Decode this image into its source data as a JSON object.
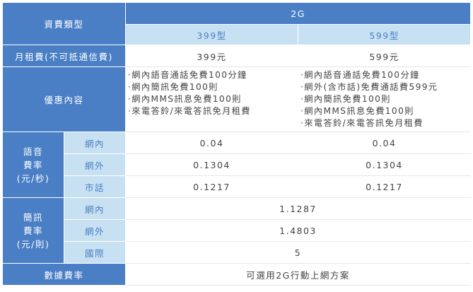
{
  "header": {
    "fee_type": "資費類型",
    "network": "2G",
    "plan_399": "399型",
    "plan_599": "599型"
  },
  "monthly": {
    "label": "月租費(不可抵通信費)",
    "p399": "399元",
    "p599": "599元"
  },
  "offers": {
    "label": "優惠內容",
    "p399": [
      "·網內語音通話免費100分鐘",
      "·網內簡訊免費100則",
      "·網內MMS訊息免費100則",
      "·來電答鈴/來電答訊免月租費"
    ],
    "p599": [
      "·網內語音通話免費100分鐘",
      "·網外(含市話)免費通話費599元",
      "·網內簡訊免費100則",
      "·網內MMS訊息免費100則",
      "·來電答鈴/來電答訊免月租費"
    ]
  },
  "voice": {
    "label_lines": [
      "語音",
      "費率",
      "(元/秒)"
    ],
    "rows": [
      {
        "label": "網內",
        "p399": "0.04",
        "p599": "0.04"
      },
      {
        "label": "網外",
        "p399": "0.1304",
        "p599": "0.1304"
      },
      {
        "label": "市話",
        "p399": "0.1217",
        "p599": "0.1217"
      }
    ]
  },
  "sms": {
    "label_lines": [
      "簡訊",
      "費率",
      "(元/則)"
    ],
    "rows": [
      {
        "label": "網內",
        "value": "1.1287"
      },
      {
        "label": "網外",
        "value": "1.4803"
      },
      {
        "label": "國際",
        "value": "5"
      }
    ]
  },
  "data_rate": {
    "label": "數據費率",
    "value": "可選用2G行動上網方案"
  }
}
